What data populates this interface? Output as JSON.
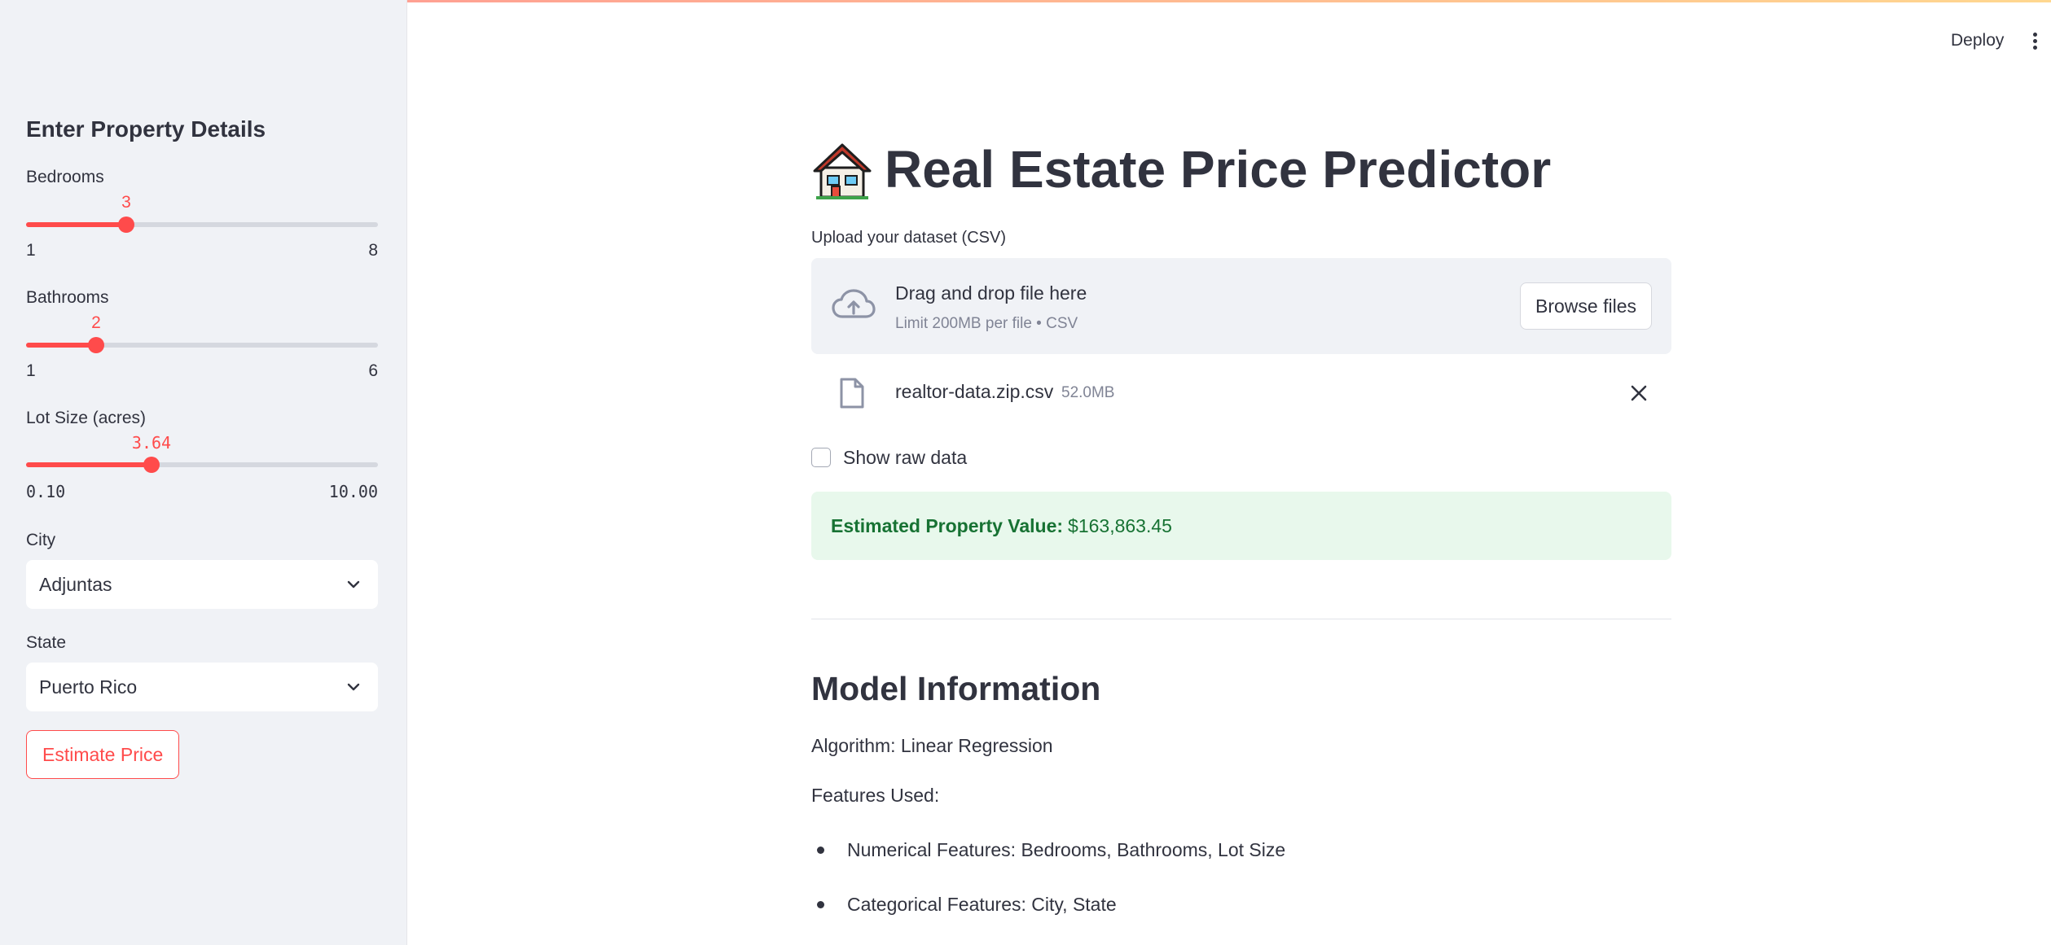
{
  "header": {
    "deploy_label": "Deploy",
    "menu_icon": "kebab-menu-icon"
  },
  "sidebar": {
    "title": "Enter Property Details",
    "bedrooms": {
      "label": "Bedrooms",
      "value": "3",
      "min": "1",
      "max": "8",
      "fraction": 0.2857
    },
    "bathrooms": {
      "label": "Bathrooms",
      "value": "2",
      "min": "1",
      "max": "6",
      "fraction": 0.2
    },
    "lot_size": {
      "label": "Lot Size (acres)",
      "value": "3.64",
      "min": "0.10",
      "max": "10.00",
      "fraction": 0.3576
    },
    "city": {
      "label": "City",
      "selected": "Adjuntas"
    },
    "state": {
      "label": "State",
      "selected": "Puerto Rico"
    },
    "estimate_button": "Estimate Price"
  },
  "main": {
    "title": "Real Estate Price Predictor",
    "title_icon": "house-emoji",
    "upload": {
      "label": "Upload your dataset (CSV)",
      "drop_title": "Drag and drop file here",
      "drop_limit": "Limit 200MB per file • CSV",
      "browse_label": "Browse files",
      "file_name": "realtor-data.zip.csv",
      "file_size": "52.0MB"
    },
    "show_raw_label": "Show raw data",
    "show_raw_checked": false,
    "result": {
      "label": "Estimated Property Value:",
      "value": "$163,863.45"
    },
    "model_info": {
      "heading": "Model Information",
      "algorithm": "Algorithm: Linear Regression",
      "features_heading": "Features Used:",
      "features": [
        "Numerical Features: Bedrooms, Bathrooms, Lot Size",
        "Categorical Features: City, State"
      ]
    }
  },
  "colors": {
    "accent": "#ff4b4b",
    "sidebar_bg": "#f0f2f6",
    "success_bg": "#e8f8ec",
    "success_text": "#177233"
  }
}
